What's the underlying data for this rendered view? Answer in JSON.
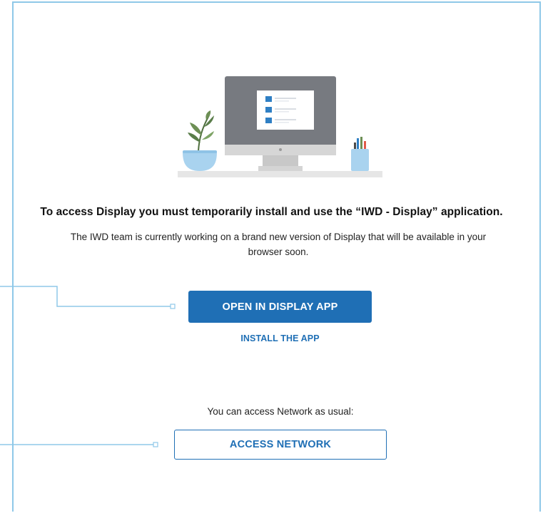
{
  "illustration": {
    "icon": "computer-desk-illustration",
    "colors": {
      "monitor": "#777a80",
      "screen": "#ffffff",
      "list_bullet": "#2f7fc4",
      "stand": "#c8c8c8",
      "desk": "#e6e6e6",
      "pot": "#a9d3ef",
      "leaf": "#5a7d4a"
    }
  },
  "message": {
    "headline": "To access Display you must temporarily install and use the “IWD - Display” application.",
    "subtext_line1": "The IWD team is currently working on a brand new version of Display that will be available in your",
    "subtext_line2": "browser soon."
  },
  "actions": {
    "open_label": "OPEN IN DISPLAY APP",
    "install_label": "INSTALL THE APP"
  },
  "network": {
    "note": "You can access Network as usual:",
    "button_label": "ACCESS NETWORK"
  },
  "theme": {
    "primary": "#1f6fb5",
    "border": "#8fc8e8"
  }
}
